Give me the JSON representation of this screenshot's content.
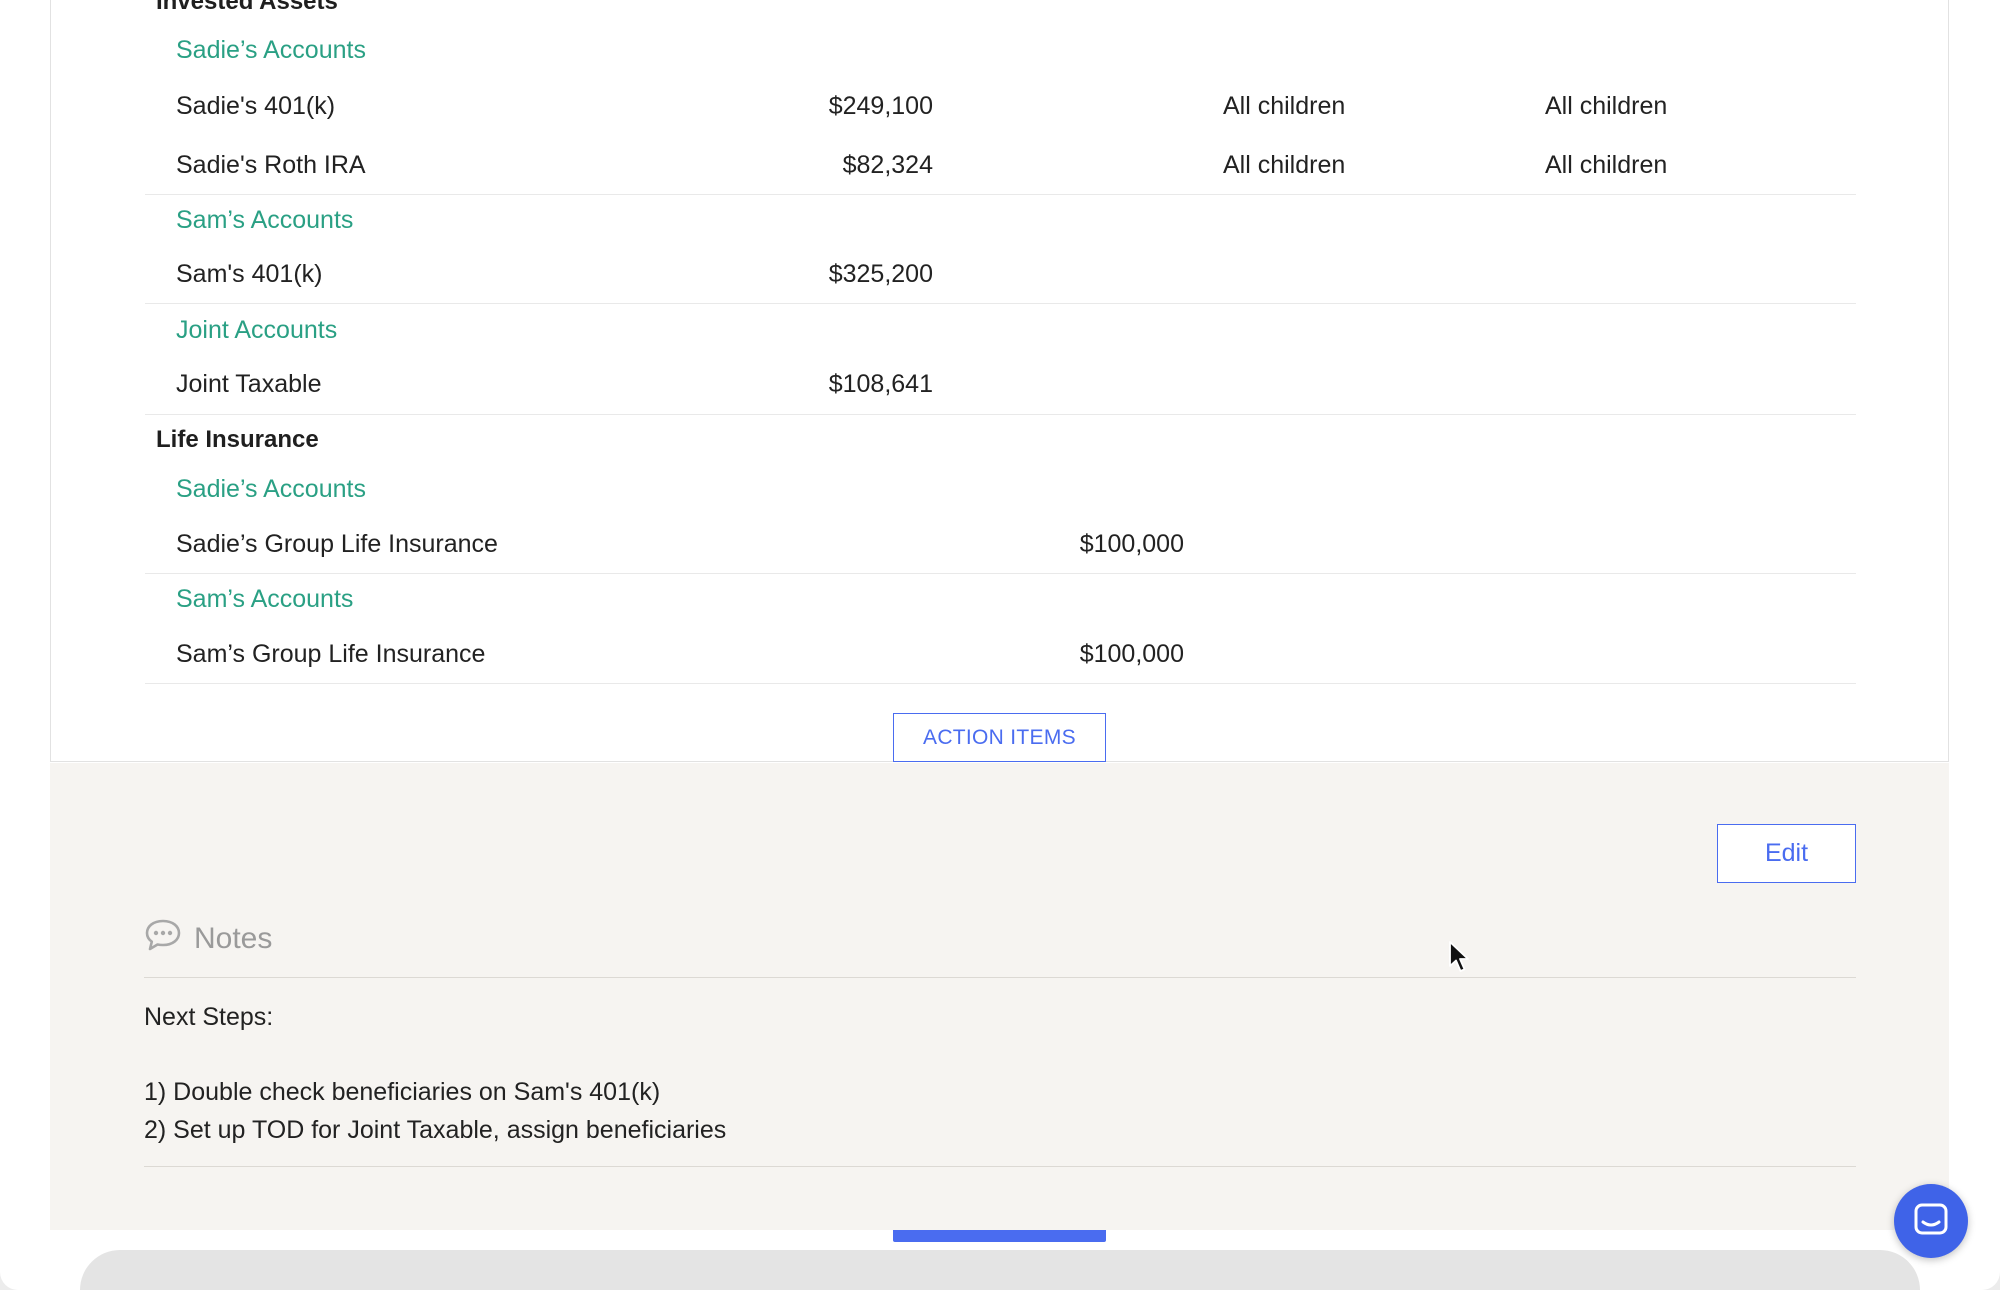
{
  "sections": {
    "invested_title": "Invested Assets",
    "life_title": "Life Insurance"
  },
  "invested": {
    "sadie_group": "Sadie’s Accounts",
    "sadie_401k": {
      "name": "Sadie's 401(k)",
      "value": "$249,100",
      "primary": "All children",
      "contingent": "All children"
    },
    "sadie_roth": {
      "name": "Sadie's Roth IRA",
      "value": "$82,324",
      "primary": "All children",
      "contingent": "All children"
    },
    "sam_group": "Sam’s Accounts",
    "sam_401k": {
      "name": "Sam's 401(k)",
      "value": "$325,200"
    },
    "joint_group": "Joint Accounts",
    "joint_taxable": {
      "name": "Joint Taxable",
      "value": "$108,641"
    }
  },
  "life": {
    "sadie_group": "Sadie’s Accounts",
    "sadie_policy": {
      "name": "Sadie’s Group Life Insurance",
      "value": "$100,000"
    },
    "sam_group": "Sam’s Accounts",
    "sam_policy": {
      "name": "Sam’s Group Life Insurance",
      "value": "$100,000"
    }
  },
  "buttons": {
    "action_items": "ACTION ITEMS",
    "edit": "Edit"
  },
  "notes": {
    "title": "Notes",
    "line1": "Next Steps:",
    "line2": "1) Double check beneficiaries on Sam's 401(k)",
    "line3": "2) Set up TOD for Joint Taxable, assign beneficiaries"
  },
  "colors": {
    "accent": "#4a6cf0",
    "group_title": "#2aa084",
    "notes_bg": "#f6f4f1"
  },
  "icons": {
    "notes": "chat-bubble-icon",
    "chat": "messenger-icon",
    "cursor": "mouse-pointer-icon"
  }
}
